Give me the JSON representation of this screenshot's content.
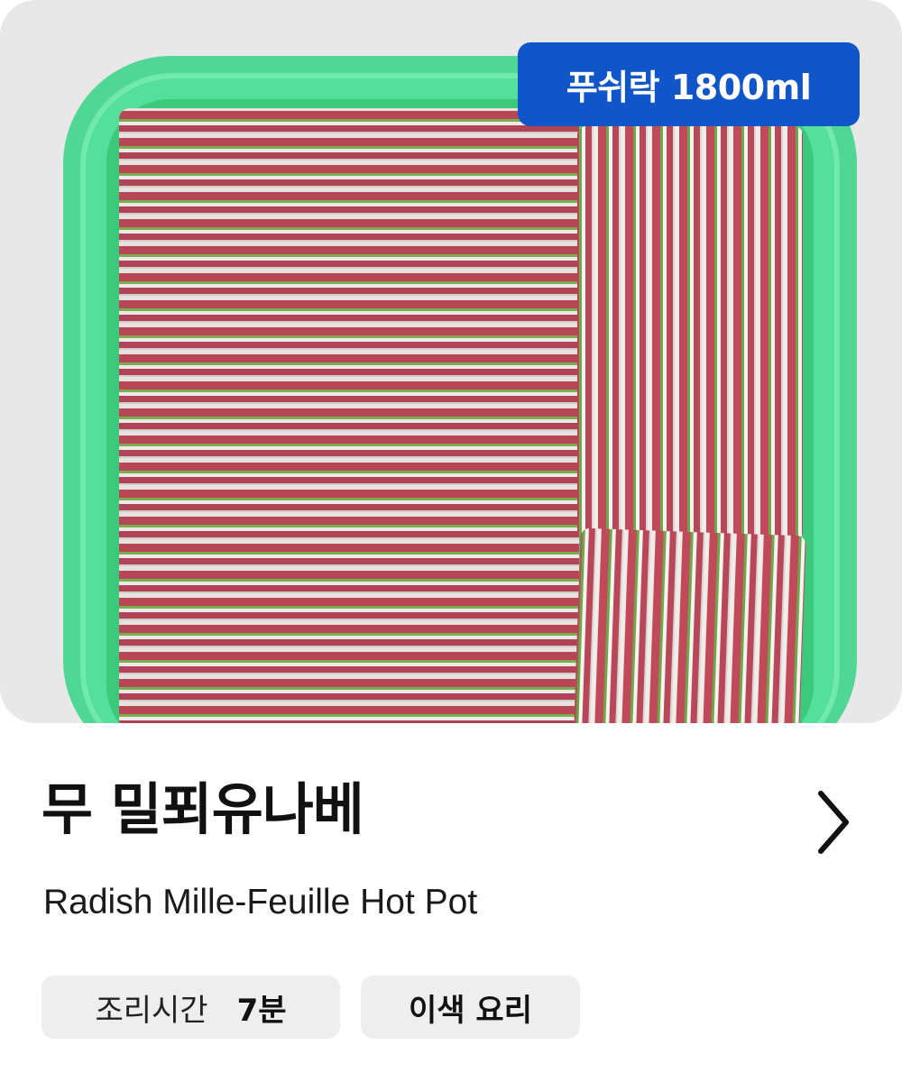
{
  "photo": {
    "badge": "푸쉬락 1800ml",
    "alt_colors": {
      "container": "#2fd27c",
      "meat": "#c4505e",
      "radish": "#f1ece8",
      "leaf": "#6aa845",
      "background": "#e9e9ea"
    }
  },
  "recipe": {
    "title": "무 밀푀유나베",
    "subtitle": "Radish Mille-Feuille Hot Pot"
  },
  "chips": {
    "time_label": "조리시간",
    "time_value": "7분",
    "tag": "이색 요리"
  },
  "icons": {
    "next": "chevron-right-icon"
  },
  "colors": {
    "badge": "#1156c9",
    "chip_bg": "#eeeeee",
    "text": "#111111"
  }
}
